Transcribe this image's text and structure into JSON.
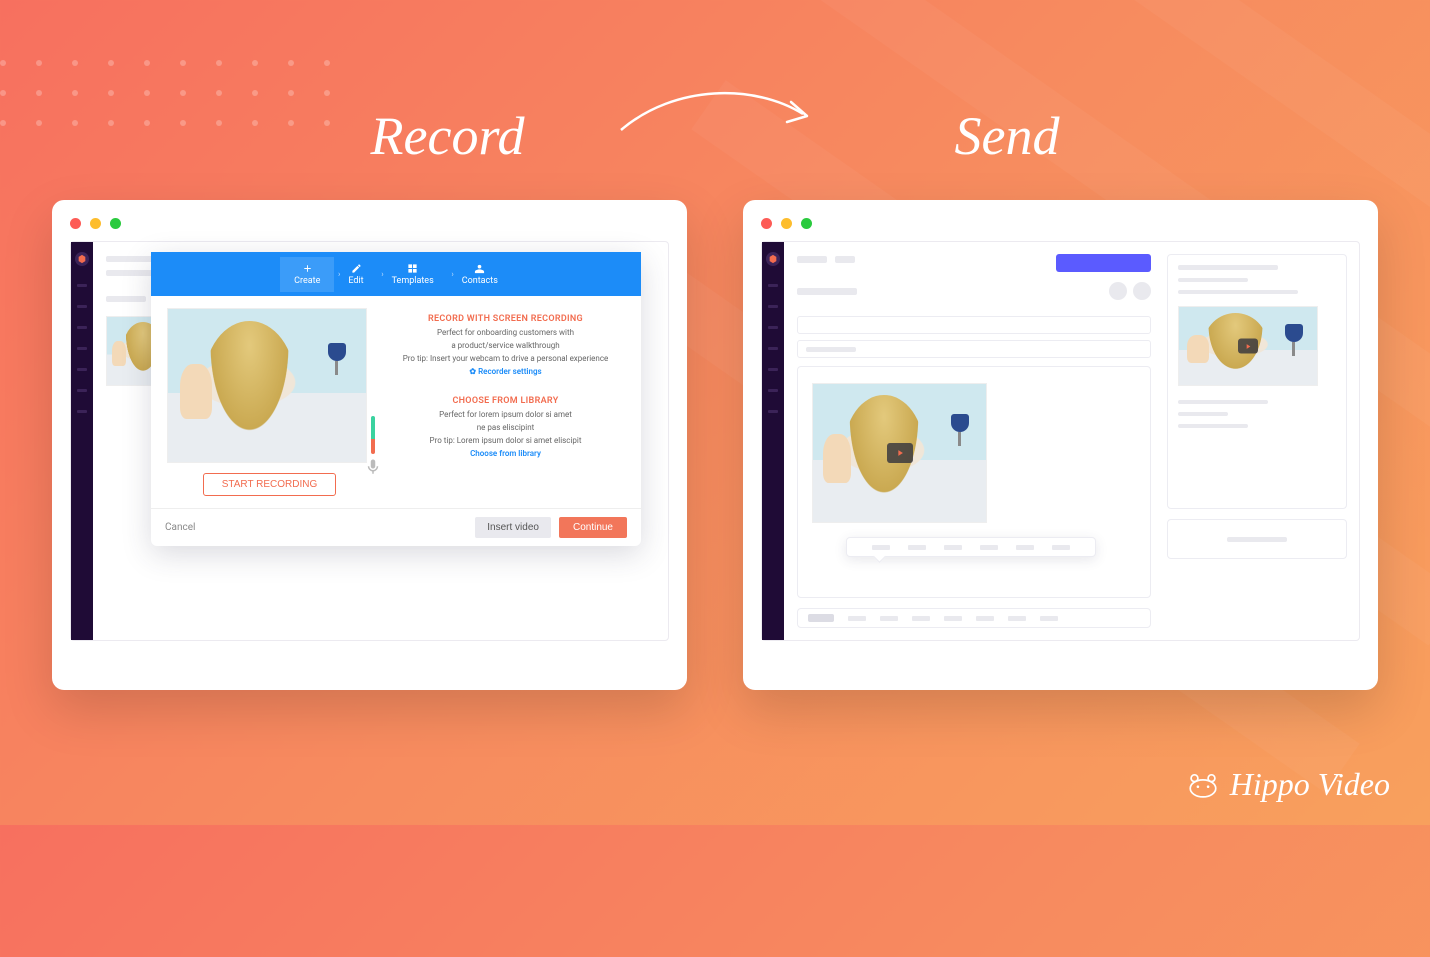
{
  "headings": {
    "record": "Record",
    "send": "Send"
  },
  "brand": "Hippo Video",
  "recordWindow": {
    "tools": {
      "create": "Create",
      "edit": "Edit",
      "templates": "Templates",
      "contacts": "Contacts"
    },
    "screenRec": {
      "title": "RECORD WITH SCREEN RECORDING",
      "line1": "Perfect for onboarding customers with",
      "line2": "a product/service walkthrough",
      "protip": "Pro tip: Insert your webcam to drive a personal experience",
      "settings": "Recorder settings"
    },
    "library": {
      "title": "CHOOSE FROM LIBRARY",
      "line1": "Perfect for lorem ipsum dolor si amet",
      "line2": "ne pas eliscipint",
      "protip": "Pro tip: Lorem ipsum dolor si amet eliscipit",
      "link": "Choose from library"
    },
    "startRecording": "START RECORDING",
    "footer": {
      "cancel": "Cancel",
      "insert": "Insert video",
      "continue": "Continue"
    }
  }
}
